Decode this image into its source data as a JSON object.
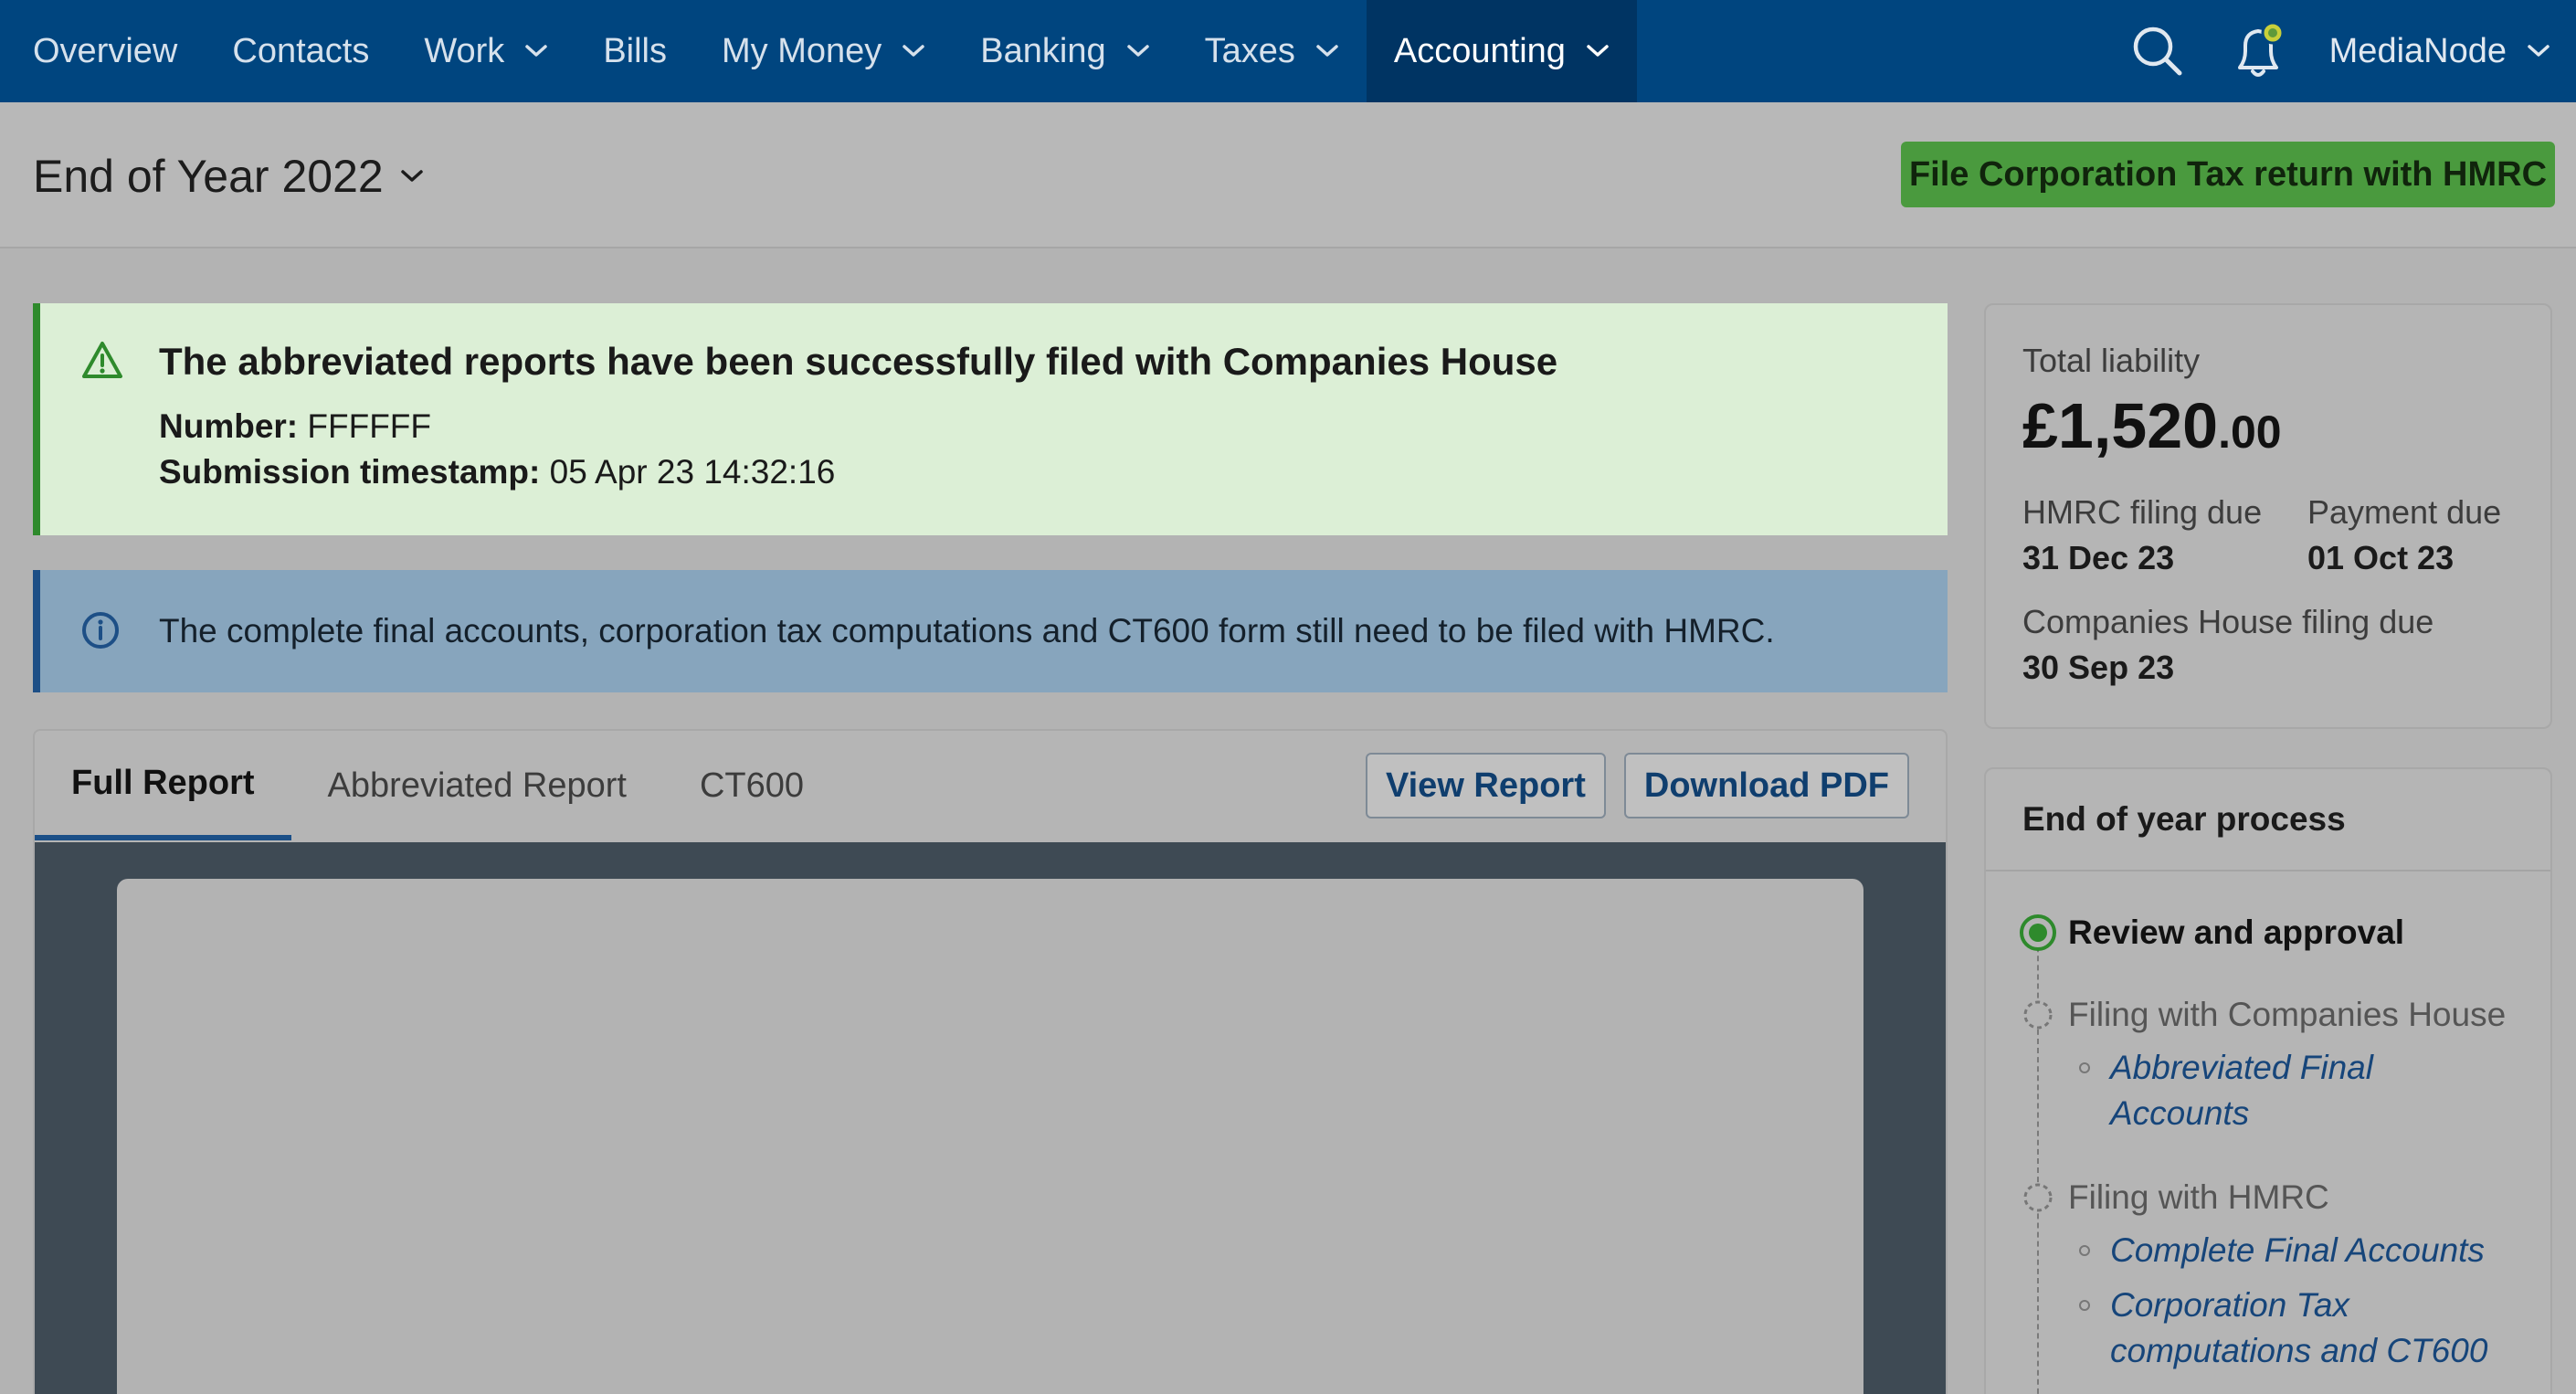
{
  "nav": {
    "items": [
      {
        "label": "Overview",
        "dropdown": false
      },
      {
        "label": "Contacts",
        "dropdown": false
      },
      {
        "label": "Work",
        "dropdown": true
      },
      {
        "label": "Bills",
        "dropdown": false
      },
      {
        "label": "My Money",
        "dropdown": true
      },
      {
        "label": "Banking",
        "dropdown": true
      },
      {
        "label": "Taxes",
        "dropdown": true
      },
      {
        "label": "Accounting",
        "dropdown": true
      }
    ],
    "active": "Accounting",
    "search_icon": "search-icon",
    "notification_icon": "bell-icon",
    "user_name": "MediaNode",
    "background": "#00457f"
  },
  "header": {
    "period": "End of Year 2022",
    "file_button": "File Corporation Tax return with HMRC",
    "file_button_color": "#4a9a3e"
  },
  "success_alert": {
    "title": "The abbreviated reports have been successfully filed with Companies House",
    "number_label": "Number:",
    "number_value": "FFFFFF",
    "timestamp_label": "Submission timestamp:",
    "timestamp_value": "05 Apr 23 14:32:16"
  },
  "info_alert": {
    "message": "The complete final accounts, corporation tax computations and CT600 form still need to be filed with HMRC."
  },
  "report": {
    "tabs": [
      "Full Report",
      "Abbreviated Report",
      "CT600"
    ],
    "active_tab": "Full Report",
    "view_button": "View Report",
    "download_button": "Download PDF"
  },
  "liability": {
    "total_label": "Total liability",
    "total_pounds": "£1,520",
    "total_pence": ".00",
    "hmrc_due_label": "HMRC filing due",
    "hmrc_due_value": "31 Dec 23",
    "payment_due_label": "Payment due",
    "payment_due_value": "01 Oct 23",
    "ch_due_label": "Companies House filing due",
    "ch_due_value": "30 Sep 23"
  },
  "process": {
    "title": "End of year process",
    "step1": "Review and approval",
    "step2": "Filing with Companies House",
    "step2_link1_line1": "Abbreviated Final",
    "step2_link1_line2": "Accounts",
    "step3": "Filing with HMRC",
    "step3_link1": "Complete Final Accounts",
    "step3_link2_line1": "Corporation Tax",
    "step3_link2_line2": "computations and CT600"
  }
}
